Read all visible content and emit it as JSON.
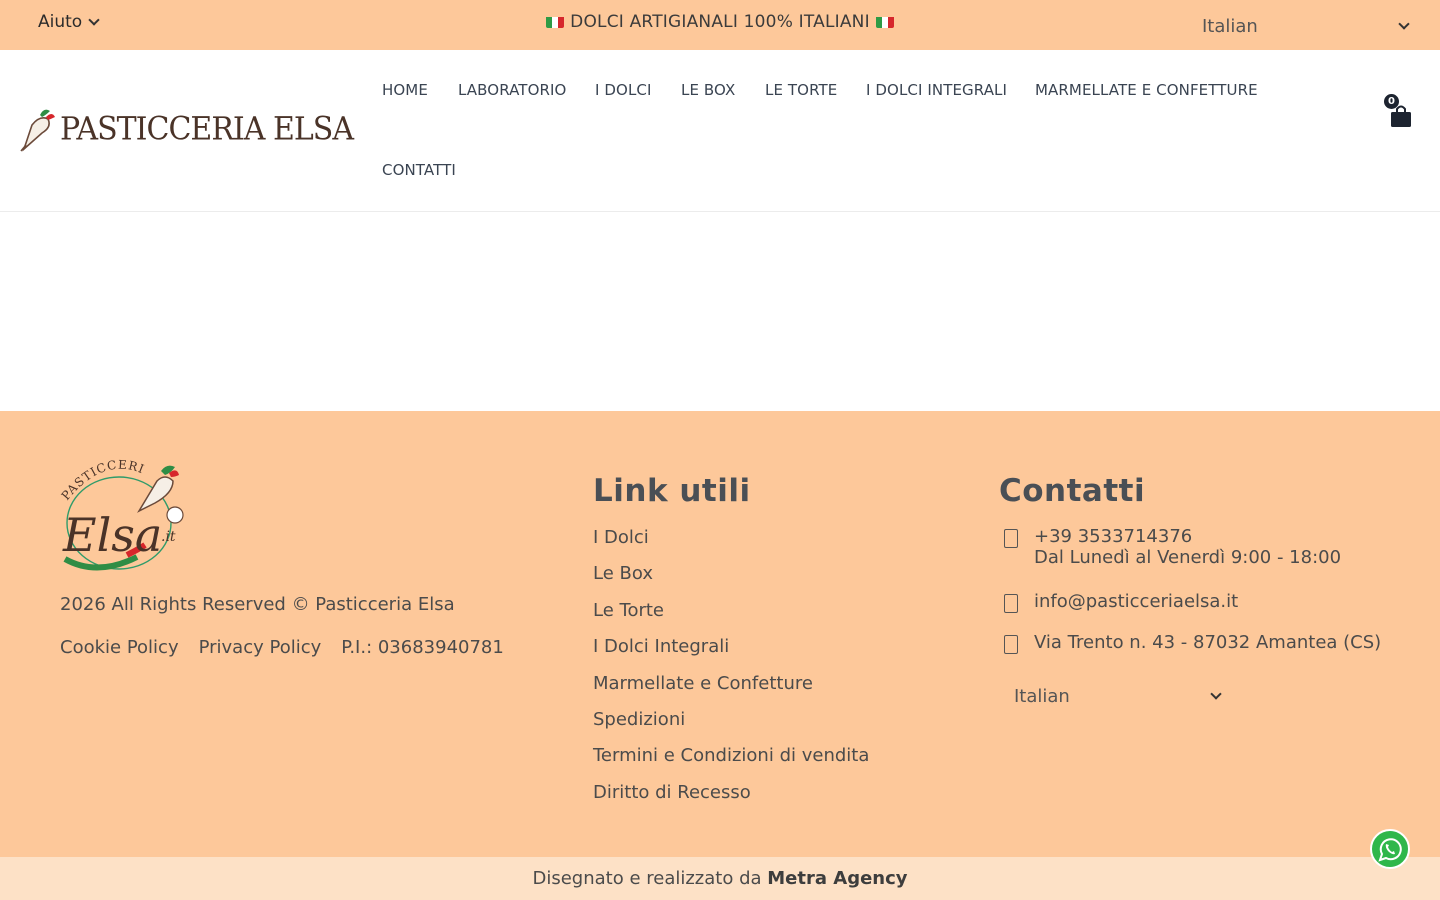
{
  "topbar": {
    "help_label": "Aiuto",
    "promo_text": "DOLCI ARTIGIANALI 100% ITALIANI",
    "language": "Italian"
  },
  "header": {
    "logo_text": "PASTICCERIA ELSA",
    "nav": [
      "HOME",
      "LABORATORIO",
      "I DOLCI",
      "LE BOX",
      "LE TORTE",
      "I DOLCI INTEGRALI",
      "MARMELLATE E CONFETTURE",
      "CONTATTI"
    ],
    "cart_count": "0"
  },
  "footer": {
    "logo_word": "Elsa",
    "logo_arc": "PASTICCERIA",
    "logo_suffix": ".it",
    "rights": "2026 All Rights Reserved © Pasticceria Elsa",
    "cookie_policy": "Cookie Policy",
    "privacy_policy": "Privacy Policy",
    "vat": "P.I.: 03683940781",
    "links_heading": "Link utili",
    "links": [
      "I Dolci",
      "Le Box",
      "Le Torte",
      "I Dolci Integrali",
      "Marmellate e Confetture",
      "Spedizioni",
      "Termini e Condizioni di vendita",
      "Diritto di Recesso"
    ],
    "contacts_heading": "Contatti",
    "phone": "+39 3533714376",
    "hours": "Dal Lunedì al Venerdì 9:00 - 18:00",
    "email": "info@pasticceriaelsa.it",
    "address": "Via Trento n. 43 - 87032 Amantea (CS)",
    "language": "Italian"
  },
  "bottombar": {
    "prefix": "Disegnato e realizzato da",
    "agency": "Metra Agency"
  },
  "colors": {
    "peach": "#fdc89a",
    "light_peach": "#fde1c6",
    "nav_text": "#3a4452",
    "whatsapp": "#2fb74b"
  },
  "icons": [
    "chevron-down-icon",
    "italy-flag-icon",
    "piping-bag-icon",
    "shopping-bag-icon",
    "phone-icon",
    "email-icon",
    "location-icon",
    "whatsapp-icon"
  ]
}
